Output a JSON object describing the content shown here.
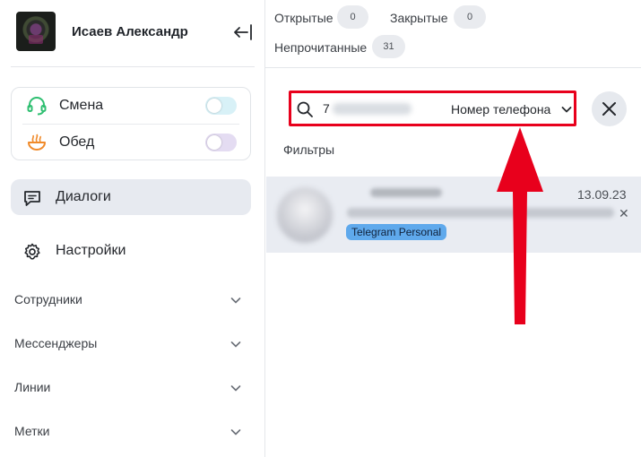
{
  "profile": {
    "name": "Исаев Александр",
    "collapse_icon": "collapse-left-icon"
  },
  "status": {
    "shift": {
      "label": "Смена",
      "icon": "headset-icon",
      "icon_color": "#2fbf71",
      "toggle_color": "#d8f1f7",
      "on": false
    },
    "lunch": {
      "label": "Обед",
      "icon": "bowl-icon",
      "icon_color": "#f08a2a",
      "toggle_color": "#e4dcf2",
      "on": false
    }
  },
  "nav": {
    "dialogs": {
      "label": "Диалоги",
      "icon": "chat-icon",
      "active": true
    },
    "settings": {
      "label": "Настройки",
      "icon": "gear-icon"
    }
  },
  "sections": [
    {
      "label": "Сотрудники"
    },
    {
      "label": "Мессенджеры"
    },
    {
      "label": "Линии"
    },
    {
      "label": "Метки"
    }
  ],
  "counters": {
    "open": {
      "label": "Открытые",
      "count": "0"
    },
    "closed": {
      "label": "Закрытые",
      "count": "0"
    },
    "unread": {
      "label": "Непрочитанные",
      "count": "31"
    }
  },
  "search": {
    "value": "7",
    "type": "Номер телефона",
    "highlight_color": "#e8001c"
  },
  "filters_label": "Фильтры",
  "dialog": {
    "date": "13.09.23",
    "tag": "Telegram Personal",
    "remove_glyph": "✕",
    "tag_color": "#5fa9ec"
  },
  "annotation": {
    "arrow_color": "#e8001c"
  }
}
